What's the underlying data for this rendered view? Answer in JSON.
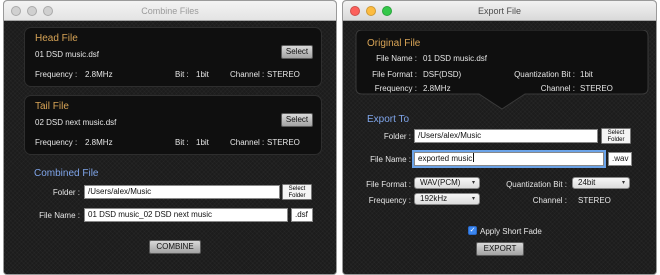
{
  "combine_window": {
    "title": "Combine Files",
    "head_file": {
      "section_title": "Head File",
      "file_name": "01 DSD music.dsf",
      "select_label": "Select",
      "frequency_label": "Frequency :",
      "frequency_value": "2.8MHz",
      "bit_label": "Bit :",
      "bit_value": "1bit",
      "channel_label": "Channel :",
      "channel_value": "STEREO"
    },
    "tail_file": {
      "section_title": "Tail File",
      "file_name": "02 DSD next music.dsf",
      "select_label": "Select",
      "frequency_label": "Frequency :",
      "frequency_value": "2.8MHz",
      "bit_label": "Bit :",
      "bit_value": "1bit",
      "channel_label": "Channel :",
      "channel_value": "STEREO"
    },
    "combined_file": {
      "section_title": "Combined File",
      "folder_label": "Folder :",
      "folder_value": "/Users/alex/Music",
      "select_folder_line1": "Select",
      "select_folder_line2": "Folder",
      "file_name_label": "File Name :",
      "file_name_value": "01 DSD music_02 DSD next music",
      "extension": ".dsf"
    },
    "combine_button": "COMBINE"
  },
  "export_window": {
    "title": "Export File",
    "original_file": {
      "section_title": "Original File",
      "file_name_label": "File Name :",
      "file_name_value": "01 DSD music.dsf",
      "file_format_label": "File Format :",
      "file_format_value": "DSF(DSD)",
      "quant_bit_label": "Quantization Bit :",
      "quant_bit_value": "1bit",
      "frequency_label": "Frequency :",
      "frequency_value": "2.8MHz",
      "channel_label": "Channel :",
      "channel_value": "STEREO"
    },
    "export_to": {
      "section_title": "Export To",
      "folder_label": "Folder :",
      "folder_value": "/Users/alex/Music",
      "select_folder_line1": "Select",
      "select_folder_line2": "Folder",
      "file_name_label": "File Name :",
      "file_name_value": "exported music",
      "extension": ".wav",
      "file_format_label": "File Format :",
      "file_format_value": "WAV(PCM)",
      "quant_bit_label": "Quantization Bit :",
      "quant_bit_value": "24bit",
      "frequency_label": "Frequency :",
      "frequency_value": "192kHz",
      "channel_label": "Channel :",
      "channel_value": "STEREO",
      "apply_fade_label": "Apply Short Fade",
      "apply_fade_checked": true
    },
    "export_button": "EXPORT"
  },
  "colors": {
    "section_orange": "#d8a456",
    "section_blue": "#7fa5ea",
    "close_red": "#fc605b",
    "minimize_yellow": "#fdbc40",
    "zoom_green": "#34c84a",
    "inactive_light": "#d0d0d0",
    "focus_ring": "#6ba3e8"
  }
}
